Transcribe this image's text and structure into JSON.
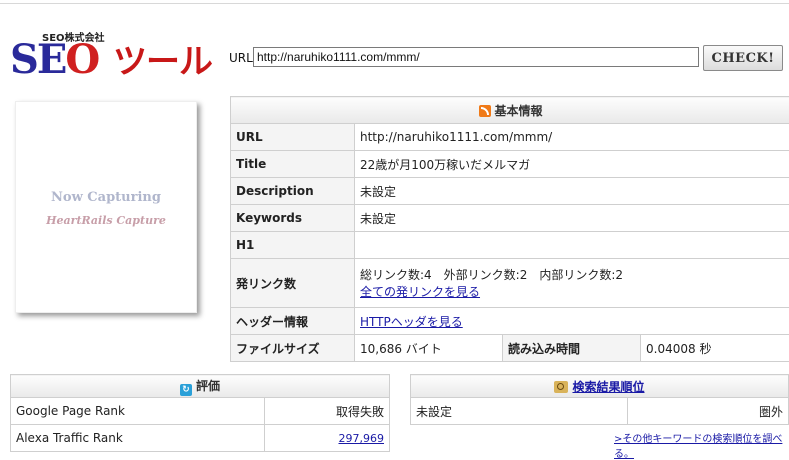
{
  "logo": {
    "sub": "SEO株式会社",
    "seo": "SE",
    "seo_o": "O",
    "tool": "ツール"
  },
  "url_bar": {
    "label": "URL",
    "value": "http://naruhiko1111.com/mmm/",
    "button": "CHECK!"
  },
  "capture": {
    "line1": "Now Capturing",
    "line2": "HeartRails Capture"
  },
  "basic_info": {
    "title": "基本情報",
    "rows": {
      "url": {
        "key": "URL",
        "value": "http://naruhiko1111.com/mmm/"
      },
      "title": {
        "key": "Title",
        "value": "22歳が月100万稼いだメルマガ"
      },
      "description": {
        "key": "Description",
        "value": "未設定"
      },
      "keywords": {
        "key": "Keywords",
        "value": "未設定"
      },
      "h1": {
        "key": "H1",
        "value": ""
      },
      "links": {
        "key": "発リンク数",
        "value": "総リンク数:4　外部リンク数:2　内部リンク数:2",
        "link": "全ての発リンクを見る"
      },
      "header": {
        "key": "ヘッダー情報",
        "link": "HTTPヘッダを見る"
      },
      "filesize": {
        "key": "ファイルサイズ",
        "value": "10,686 バイト",
        "load_key": "読み込み時間",
        "load_value": "0.04008 秒"
      }
    }
  },
  "evaluation": {
    "title": "評価",
    "rows": {
      "pagerank": {
        "key": "Google Page Rank",
        "value": "取得失敗"
      },
      "alexa": {
        "key": "Alexa Traffic Rank",
        "value": "297,969"
      }
    }
  },
  "search_rank": {
    "title": "検索結果順位",
    "row": {
      "key": "未設定",
      "value": "圏外"
    },
    "more_link": ">その他キーワードの検索順位を調べる。"
  },
  "colors": {
    "link": "#1a1aa6",
    "logo_blue": "#2a2a9a",
    "logo_red": "#c81818",
    "rss": "#f07a18"
  }
}
